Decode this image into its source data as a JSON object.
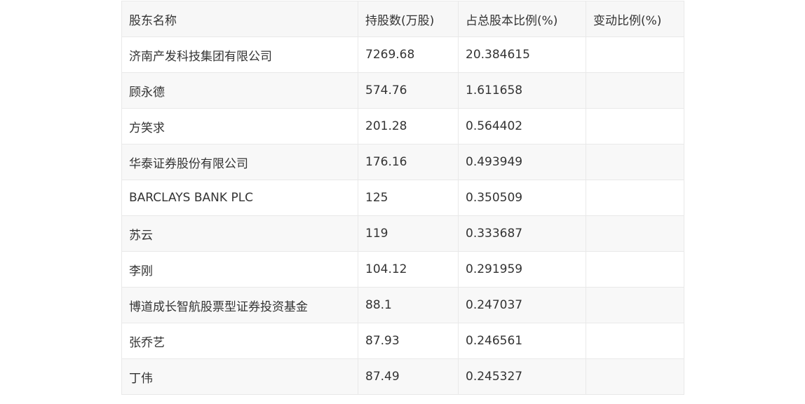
{
  "table": {
    "headers": [
      "股东名称",
      "持股数(万股)",
      "占总股本比例(%)",
      "变动比例(%)"
    ],
    "rows": [
      [
        "济南产发科技集团有限公司",
        "7269.68",
        "20.384615",
        ""
      ],
      [
        "顾永德",
        "574.76",
        "1.611658",
        ""
      ],
      [
        "方笑求",
        "201.28",
        "0.564402",
        ""
      ],
      [
        "华泰证券股份有限公司",
        "176.16",
        "0.493949",
        ""
      ],
      [
        "BARCLAYS BANK PLC",
        "125",
        "0.350509",
        ""
      ],
      [
        "苏云",
        "119",
        "0.333687",
        ""
      ],
      [
        "李刚",
        "104.12",
        "0.291959",
        ""
      ],
      [
        "博道成长智航股票型证券投资基金",
        "88.1",
        "0.247037",
        ""
      ],
      [
        "张乔艺",
        "87.93",
        "0.246561",
        ""
      ],
      [
        "丁伟",
        "87.49",
        "0.245327",
        ""
      ]
    ]
  }
}
